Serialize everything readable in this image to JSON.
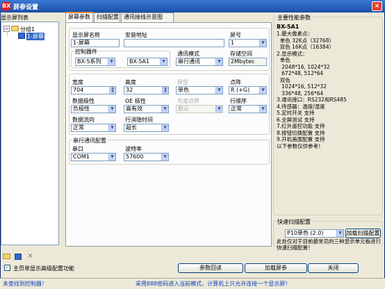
{
  "window": {
    "title": "屏参设置",
    "app_icon": "BX",
    "close": "×"
  },
  "left_panel": {
    "header": "显示屏列表",
    "tree": {
      "group": "分组1",
      "screen": "1-屏幕",
      "expand_toggle": "−"
    }
  },
  "tabs": [
    {
      "label": "屏幕参数",
      "active": true
    },
    {
      "label": "扫描配置",
      "active": false
    },
    {
      "label": "通讯接线示意图",
      "active": false
    }
  ],
  "screen_params": {
    "name_label": "显示屏名称",
    "name_value": "1-屏幕",
    "addr_label": "安装地址",
    "addr_value": "",
    "num_label": "屏号",
    "num_value": "1",
    "controller_group_label": "控制器件",
    "controller_series": "BX-5系列",
    "controller_model": "BX-5A1",
    "comm_mode_label": "通讯模式",
    "comm_mode_value": "串行通讯",
    "storage_label": "存储空间",
    "storage_value": "2Mbytes",
    "width_label": "宽度",
    "width_value": "704",
    "height_label": "高度",
    "height_value": "32",
    "color_label": "屏型",
    "color_value": "单色",
    "matrix_label": "点阵",
    "matrix_value": "R (+G)",
    "data_polarity_label": "数据极性",
    "data_polarity_value": "负极性",
    "oe_polarity_label": "OE 极性",
    "oe_polarity_value": "高有效",
    "gray_label": "灰度点阵",
    "gray_value": "默认",
    "row_order_label": "行顺序",
    "row_order_value": "正常",
    "data_dir_label": "数据流向",
    "data_dir_value": "正常",
    "row_blank_label": "行消隐时间",
    "row_blank_value": "超长",
    "serial_group_label": "串行通讯配置",
    "port_label": "串口",
    "port_value": "COM1",
    "baud_label": "波特率",
    "baud_value": "57600",
    "arrow": "▼",
    "spin_up": "▲",
    "spin_down": "▼"
  },
  "info_panel": {
    "header": "主要性能参数",
    "model": "BX-5A1",
    "text": "1.最大像素点：\n  单色 32K点（32768）\n  双色 16K点（16384）\n2.显示模式：\n  单色\n   2048*16, 1024*32\n   672*48, 512*64\n  双色\n   1024*16, 512*32\n   336*48, 256*64\n3.通讯接口：RS232和RS485\n4.传感器：温度/湿度\n5.定时开关 支持\n6.全屏测试 支持\n7.红外遥控功能 支持\n8.按钮切换配置 支持\n9.开机画面配置 支持\n以下参数仅供参考！"
  },
  "quick_scan": {
    "label": "快速扫描配置",
    "select_value": "P10单色 (2.0)",
    "load_button": "加载扫描配置",
    "note": "此处仅对于目前最常见的三种显示单元板进行快速扫描配置！"
  },
  "left_toolbar": {
    "add_folder": "+",
    "add_screen": "□",
    "delete": "✕"
  },
  "checkbox": {
    "label": "主页单显示高级配置功能",
    "checked": true
  },
  "buttons": {
    "read_back": "参数回读",
    "load_params": "加载屏参",
    "close": "关闭"
  },
  "status": {
    "left": "未查找到控制器！",
    "right": "采用888密码进入当前模式，计算机上只允许连接一个显示屏！"
  },
  "colors": {
    "title_bar": "#1c4fa8",
    "status_text": "#1040c0",
    "accent_tab": "#e68b2c"
  }
}
